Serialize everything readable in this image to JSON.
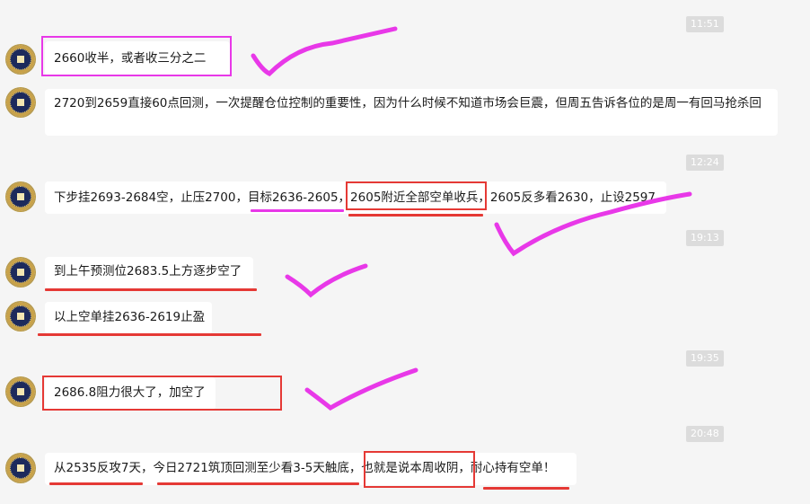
{
  "messages": [
    {
      "time": "11:51",
      "text": "2660收半，或者收三分之二"
    },
    {
      "text": "2720到2659直接60点回测，一次提醒仓位控制的重要性，因为什么时候不知道市场会巨震，但周五告诉各位的是周一有回马抢杀回"
    },
    {
      "time": "12:24",
      "segments": [
        "下步挂2693-2684空，止压2700，",
        "目标2636-2605，",
        "2605附近全部空单收兵，",
        "2605反多看2630，止设2597"
      ]
    },
    {
      "time": "19:13",
      "text": "到上午预测位2683.5上方逐步空了"
    },
    {
      "text": "以上空单挂2636-2619止盈"
    },
    {
      "time": "19:35",
      "text": "2686.8阻力很大了，加空了"
    },
    {
      "time": "20:48",
      "segments": [
        "从2535反攻7天，",
        "今日2721筑顶回测至少看3-5天触底，",
        "也就是说本周收阴，",
        "耐心持有空单！"
      ]
    }
  ],
  "colors": {
    "annotation_red": "#e53935",
    "annotation_magenta": "#e838e8",
    "bubble": "#ffffff",
    "background": "#f5f5f5"
  }
}
